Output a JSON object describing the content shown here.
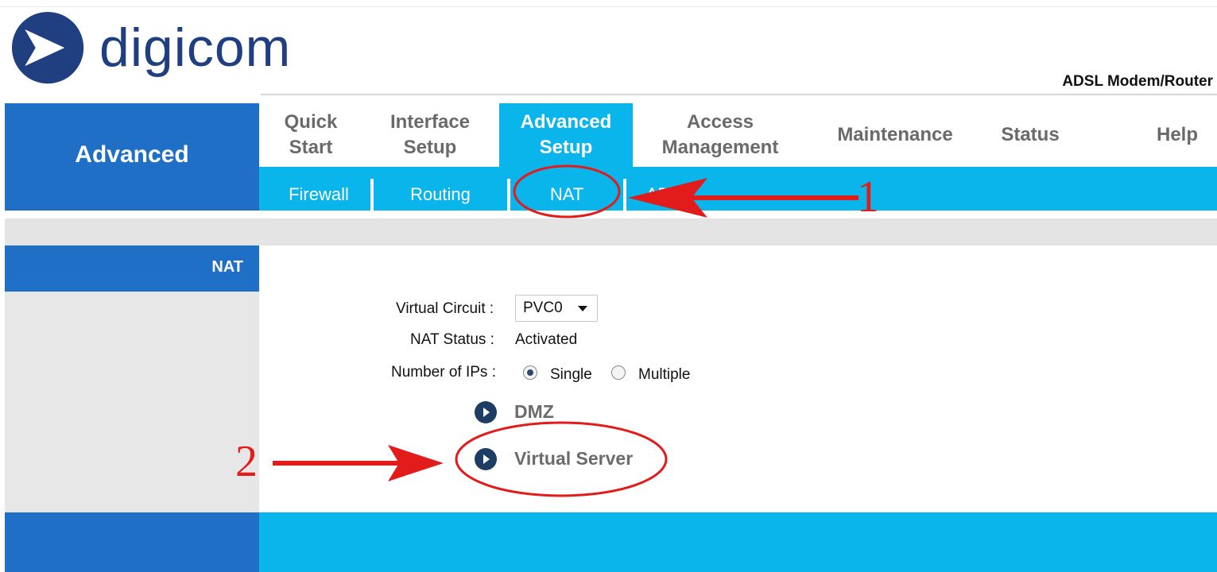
{
  "brand": {
    "logo_text": "digicom",
    "product": "ADSL Modem/Router",
    "logo_color": "#1f3f80"
  },
  "section_title": "Advanced",
  "main_nav": [
    {
      "label": "Quick\nStart"
    },
    {
      "label": "Interface\nSetup"
    },
    {
      "label": "Advanced\nSetup",
      "active": true
    },
    {
      "label": "Access\nManagement"
    },
    {
      "label": "Maintenance"
    },
    {
      "label": "Status"
    },
    {
      "label": "Help"
    }
  ],
  "sub_nav": [
    {
      "label": "Firewall"
    },
    {
      "label": "Routing"
    },
    {
      "label": "NAT",
      "active": true
    },
    {
      "label": "AD"
    }
  ],
  "left_panel_label": "NAT",
  "form": {
    "virtual_circuit_label": "Virtual Circuit :",
    "virtual_circuit_value": "PVC0",
    "nat_status_label": "NAT Status :",
    "nat_status_value": "Activated",
    "num_ips_label": "Number of IPs :",
    "num_ips_options": [
      "Single",
      "Multiple"
    ],
    "num_ips_selected": "Single"
  },
  "links": {
    "dmz": "DMZ",
    "virtual_server": "Virtual Server"
  },
  "annotations": {
    "step1": "1",
    "step2": "2"
  },
  "colors": {
    "primary_blue": "#1f6fc6",
    "accent_cyan": "#0ab5ec",
    "annotation_red": "#e21b1b"
  }
}
